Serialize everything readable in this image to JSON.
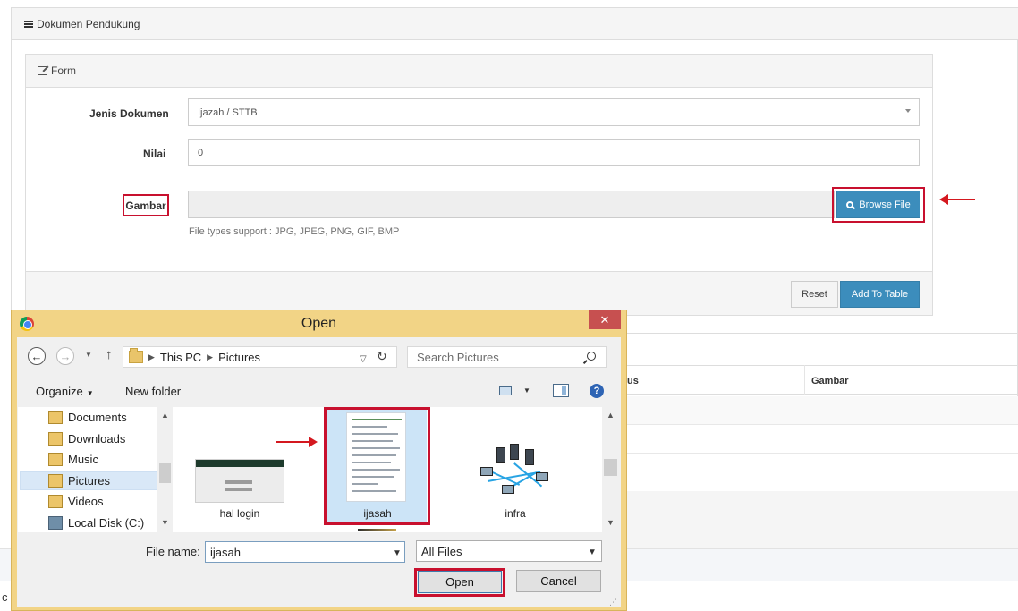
{
  "page": {
    "outer_title": "Dokumen Pendukung",
    "form_title": "Form",
    "fields": {
      "jenis_label": "Jenis Dokumen",
      "jenis_value": "Ijazah / STTB",
      "nilai_label": "Nilai",
      "nilai_value": "0",
      "gambar_label": "Gambar",
      "browse_label": "Browse File",
      "file_hint": "File types support : JPG, JPEG, PNG, GIF, BMP"
    },
    "buttons": {
      "reset": "Reset",
      "add_to_table": "Add To Table"
    },
    "table": {
      "col_status_partial": "us",
      "col_gambar": "Gambar"
    },
    "edge_text": "c",
    "colors": {
      "primary": "#3c8dbc",
      "highlight": "#c8102e"
    }
  },
  "dialog": {
    "title": "Open",
    "close_glyph": "✕",
    "breadcrumb": [
      "This PC",
      "Pictures"
    ],
    "search_placeholder": "Search Pictures",
    "toolbar": {
      "organize": "Organize",
      "new_folder": "New folder",
      "help_glyph": "?"
    },
    "nav_items": [
      "Documents",
      "Downloads",
      "Music",
      "Pictures",
      "Videos",
      "Local Disk (C:)"
    ],
    "files": [
      "hal login",
      "ijasah",
      "infra"
    ],
    "file_name_label": "File name:",
    "file_name_value": "ijasah",
    "file_type": "All Files",
    "open": "Open",
    "cancel": "Cancel"
  }
}
